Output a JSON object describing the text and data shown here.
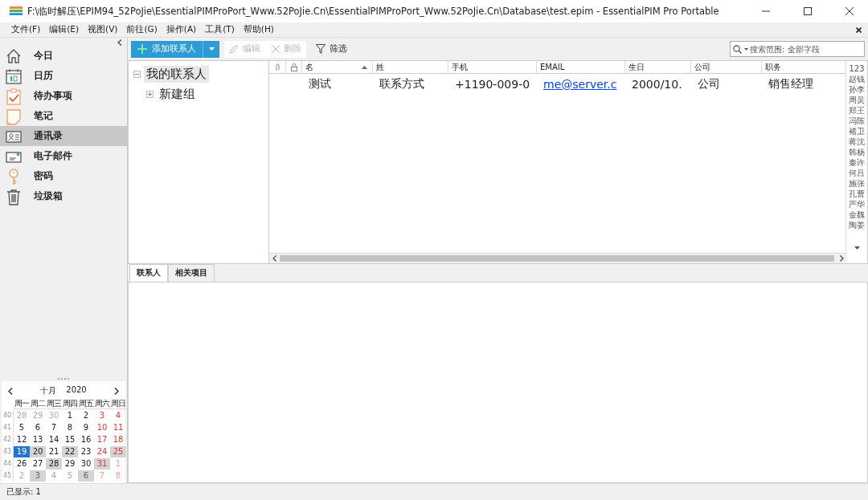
{
  "window": {
    "title": "F:\\临时解压\\EPIM94_52PoJie\\EssentialPIMProPort_Www.52PoJie.Cn\\EssentialPIMProPort_Www.52PoJie.Cn\\Database\\test.epim - EssentialPIM Pro Portable"
  },
  "menu": [
    "文件(F)",
    "编辑(E)",
    "视图(V)",
    "前往(G)",
    "操作(A)",
    "工具(T)",
    "帮助(H)"
  ],
  "toolbar": {
    "add": {
      "label": "添加联系人"
    },
    "edit": {
      "label": "编辑",
      "disabled": true
    },
    "delete": {
      "label": "删除",
      "disabled": true
    },
    "filter": {
      "label": "筛选"
    },
    "search": {
      "placeholder": "搜索范围: 全部字段"
    }
  },
  "sidebar": {
    "items": [
      {
        "label": "今日",
        "selected": false
      },
      {
        "label": "日历",
        "selected": false
      },
      {
        "label": "待办事项",
        "selected": false
      },
      {
        "label": "笔记",
        "selected": false
      },
      {
        "label": "通讯录",
        "selected": true
      },
      {
        "label": "电子邮件",
        "selected": false
      },
      {
        "label": "密码",
        "selected": false
      },
      {
        "label": "垃圾箱",
        "selected": false
      }
    ]
  },
  "tree": [
    {
      "label": "我的联系人",
      "selected": true,
      "expanded": true,
      "children": [
        {
          "label": "新建组",
          "selected": false,
          "expanded": false
        }
      ]
    }
  ],
  "table": {
    "columns": [
      {
        "label": "名",
        "kind": "text",
        "sorted": true
      },
      {
        "label": "姓",
        "kind": "text",
        "sorted": false
      },
      {
        "label": "手机",
        "kind": "text",
        "sorted": false
      },
      {
        "label": "EMAIL",
        "kind": "link",
        "sorted": false
      },
      {
        "label": "生日",
        "kind": "text",
        "sorted": false
      },
      {
        "label": "公司",
        "kind": "text",
        "sorted": false
      },
      {
        "label": "职务",
        "kind": "text",
        "sorted": false
      }
    ],
    "rows": [
      {
        "cells": [
          "测试",
          "联系方式",
          "+1190-009-0",
          "me@server.c",
          "2000/10.",
          "公司",
          "销售经理"
        ]
      }
    ]
  },
  "index": [
    "123",
    "赵钱",
    "孙李",
    "周吴",
    "郑王",
    "冯陈",
    "褚卫",
    "蒋沈",
    "韩杨",
    "秦许",
    "何吕",
    "施张",
    "孔曹",
    "严华",
    "金魏",
    "陶姜"
  ],
  "detail_tabs": [
    {
      "label": "联系人",
      "selected": true
    },
    {
      "label": "相关项目",
      "selected": false
    }
  ],
  "calendar": {
    "month": "十月",
    "year": "2020",
    "weekdays": [
      "周一",
      "周二",
      "周三",
      "周四",
      "周五",
      "周六",
      "周日"
    ],
    "weeks": [
      {
        "number": "40",
        "days": [
          {
            "d": "28",
            "other": true,
            "marked": false,
            "selected": false
          },
          {
            "d": "29",
            "other": true,
            "marked": false,
            "selected": false
          },
          {
            "d": "30",
            "other": true,
            "marked": false,
            "selected": false
          },
          {
            "d": "1",
            "other": false,
            "marked": false,
            "selected": false
          },
          {
            "d": "2",
            "other": false,
            "marked": false,
            "selected": false
          },
          {
            "d": "3",
            "other": false,
            "marked": false,
            "selected": false
          },
          {
            "d": "4",
            "other": false,
            "marked": false,
            "selected": false
          }
        ]
      },
      {
        "number": "41",
        "days": [
          {
            "d": "5",
            "other": false,
            "marked": false,
            "selected": false
          },
          {
            "d": "6",
            "other": false,
            "marked": false,
            "selected": false
          },
          {
            "d": "7",
            "other": false,
            "marked": false,
            "selected": false
          },
          {
            "d": "8",
            "other": false,
            "marked": false,
            "selected": false
          },
          {
            "d": "9",
            "other": false,
            "marked": false,
            "selected": false
          },
          {
            "d": "10",
            "other": false,
            "marked": false,
            "selected": false
          },
          {
            "d": "11",
            "other": false,
            "marked": false,
            "selected": false
          }
        ]
      },
      {
        "number": "42",
        "days": [
          {
            "d": "12",
            "other": false,
            "marked": false,
            "selected": false
          },
          {
            "d": "13",
            "other": false,
            "marked": false,
            "selected": false
          },
          {
            "d": "14",
            "other": false,
            "marked": false,
            "selected": false
          },
          {
            "d": "15",
            "other": false,
            "marked": false,
            "selected": false
          },
          {
            "d": "16",
            "other": false,
            "marked": false,
            "selected": false
          },
          {
            "d": "17",
            "other": false,
            "marked": false,
            "selected": false
          },
          {
            "d": "18",
            "other": false,
            "marked": false,
            "selected": false
          }
        ]
      },
      {
        "number": "43",
        "days": [
          {
            "d": "19",
            "other": false,
            "marked": false,
            "selected": true
          },
          {
            "d": "20",
            "other": false,
            "marked": true,
            "selected": false
          },
          {
            "d": "21",
            "other": false,
            "marked": false,
            "selected": false
          },
          {
            "d": "22",
            "other": false,
            "marked": true,
            "selected": false
          },
          {
            "d": "23",
            "other": false,
            "marked": false,
            "selected": false
          },
          {
            "d": "24",
            "other": false,
            "marked": false,
            "selected": false
          },
          {
            "d": "25",
            "other": false,
            "marked": true,
            "selected": false
          }
        ]
      },
      {
        "number": "44",
        "days": [
          {
            "d": "26",
            "other": false,
            "marked": false,
            "selected": false
          },
          {
            "d": "27",
            "other": false,
            "marked": false,
            "selected": false
          },
          {
            "d": "28",
            "other": false,
            "marked": true,
            "selected": false
          },
          {
            "d": "29",
            "other": false,
            "marked": false,
            "selected": false
          },
          {
            "d": "30",
            "other": false,
            "marked": false,
            "selected": false
          },
          {
            "d": "31",
            "other": false,
            "marked": true,
            "selected": false
          },
          {
            "d": "1",
            "other": true,
            "marked": false,
            "selected": false
          }
        ]
      },
      {
        "number": "45",
        "days": [
          {
            "d": "2",
            "other": true,
            "marked": false,
            "selected": false
          },
          {
            "d": "3",
            "other": true,
            "marked": true,
            "selected": false
          },
          {
            "d": "4",
            "other": true,
            "marked": false,
            "selected": false
          },
          {
            "d": "5",
            "other": true,
            "marked": false,
            "selected": false
          },
          {
            "d": "6",
            "other": true,
            "marked": true,
            "selected": false
          },
          {
            "d": "7",
            "other": true,
            "marked": false,
            "selected": false
          },
          {
            "d": "8",
            "other": true,
            "marked": false,
            "selected": false
          }
        ]
      }
    ]
  },
  "status_bar": "已显示: 1"
}
